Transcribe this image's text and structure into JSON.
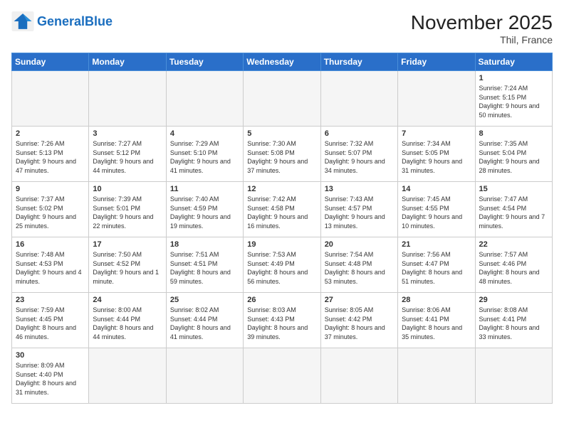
{
  "header": {
    "logo_general": "General",
    "logo_blue": "Blue",
    "title": "November 2025",
    "subtitle": "Thil, France"
  },
  "days_of_week": [
    "Sunday",
    "Monday",
    "Tuesday",
    "Wednesday",
    "Thursday",
    "Friday",
    "Saturday"
  ],
  "weeks": [
    [
      {
        "day": "",
        "empty": true
      },
      {
        "day": "",
        "empty": true
      },
      {
        "day": "",
        "empty": true
      },
      {
        "day": "",
        "empty": true
      },
      {
        "day": "",
        "empty": true
      },
      {
        "day": "",
        "empty": true
      },
      {
        "day": "1",
        "sunrise": "7:24 AM",
        "sunset": "5:15 PM",
        "daylight": "9 hours and 50 minutes."
      }
    ],
    [
      {
        "day": "2",
        "sunrise": "7:26 AM",
        "sunset": "5:13 PM",
        "daylight": "9 hours and 47 minutes."
      },
      {
        "day": "3",
        "sunrise": "7:27 AM",
        "sunset": "5:12 PM",
        "daylight": "9 hours and 44 minutes."
      },
      {
        "day": "4",
        "sunrise": "7:29 AM",
        "sunset": "5:10 PM",
        "daylight": "9 hours and 41 minutes."
      },
      {
        "day": "5",
        "sunrise": "7:30 AM",
        "sunset": "5:08 PM",
        "daylight": "9 hours and 37 minutes."
      },
      {
        "day": "6",
        "sunrise": "7:32 AM",
        "sunset": "5:07 PM",
        "daylight": "9 hours and 34 minutes."
      },
      {
        "day": "7",
        "sunrise": "7:34 AM",
        "sunset": "5:05 PM",
        "daylight": "9 hours and 31 minutes."
      },
      {
        "day": "8",
        "sunrise": "7:35 AM",
        "sunset": "5:04 PM",
        "daylight": "9 hours and 28 minutes."
      }
    ],
    [
      {
        "day": "9",
        "sunrise": "7:37 AM",
        "sunset": "5:02 PM",
        "daylight": "9 hours and 25 minutes."
      },
      {
        "day": "10",
        "sunrise": "7:39 AM",
        "sunset": "5:01 PM",
        "daylight": "9 hours and 22 minutes."
      },
      {
        "day": "11",
        "sunrise": "7:40 AM",
        "sunset": "4:59 PM",
        "daylight": "9 hours and 19 minutes."
      },
      {
        "day": "12",
        "sunrise": "7:42 AM",
        "sunset": "4:58 PM",
        "daylight": "9 hours and 16 minutes."
      },
      {
        "day": "13",
        "sunrise": "7:43 AM",
        "sunset": "4:57 PM",
        "daylight": "9 hours and 13 minutes."
      },
      {
        "day": "14",
        "sunrise": "7:45 AM",
        "sunset": "4:55 PM",
        "daylight": "9 hours and 10 minutes."
      },
      {
        "day": "15",
        "sunrise": "7:47 AM",
        "sunset": "4:54 PM",
        "daylight": "9 hours and 7 minutes."
      }
    ],
    [
      {
        "day": "16",
        "sunrise": "7:48 AM",
        "sunset": "4:53 PM",
        "daylight": "9 hours and 4 minutes."
      },
      {
        "day": "17",
        "sunrise": "7:50 AM",
        "sunset": "4:52 PM",
        "daylight": "9 hours and 1 minute."
      },
      {
        "day": "18",
        "sunrise": "7:51 AM",
        "sunset": "4:51 PM",
        "daylight": "8 hours and 59 minutes."
      },
      {
        "day": "19",
        "sunrise": "7:53 AM",
        "sunset": "4:49 PM",
        "daylight": "8 hours and 56 minutes."
      },
      {
        "day": "20",
        "sunrise": "7:54 AM",
        "sunset": "4:48 PM",
        "daylight": "8 hours and 53 minutes."
      },
      {
        "day": "21",
        "sunrise": "7:56 AM",
        "sunset": "4:47 PM",
        "daylight": "8 hours and 51 minutes."
      },
      {
        "day": "22",
        "sunrise": "7:57 AM",
        "sunset": "4:46 PM",
        "daylight": "8 hours and 48 minutes."
      }
    ],
    [
      {
        "day": "23",
        "sunrise": "7:59 AM",
        "sunset": "4:45 PM",
        "daylight": "8 hours and 46 minutes."
      },
      {
        "day": "24",
        "sunrise": "8:00 AM",
        "sunset": "4:44 PM",
        "daylight": "8 hours and 44 minutes."
      },
      {
        "day": "25",
        "sunrise": "8:02 AM",
        "sunset": "4:44 PM",
        "daylight": "8 hours and 41 minutes."
      },
      {
        "day": "26",
        "sunrise": "8:03 AM",
        "sunset": "4:43 PM",
        "daylight": "8 hours and 39 minutes."
      },
      {
        "day": "27",
        "sunrise": "8:05 AM",
        "sunset": "4:42 PM",
        "daylight": "8 hours and 37 minutes."
      },
      {
        "day": "28",
        "sunrise": "8:06 AM",
        "sunset": "4:41 PM",
        "daylight": "8 hours and 35 minutes."
      },
      {
        "day": "29",
        "sunrise": "8:08 AM",
        "sunset": "4:41 PM",
        "daylight": "8 hours and 33 minutes."
      }
    ],
    [
      {
        "day": "30",
        "sunrise": "8:09 AM",
        "sunset": "4:40 PM",
        "daylight": "8 hours and 31 minutes."
      },
      {
        "day": "",
        "empty": true
      },
      {
        "day": "",
        "empty": true
      },
      {
        "day": "",
        "empty": true
      },
      {
        "day": "",
        "empty": true
      },
      {
        "day": "",
        "empty": true
      },
      {
        "day": "",
        "empty": true
      }
    ]
  ]
}
